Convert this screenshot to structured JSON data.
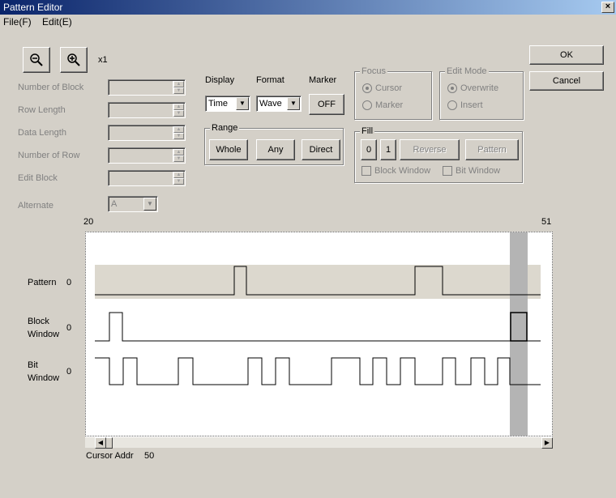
{
  "window": {
    "title": "Pattern Editor",
    "close": "×"
  },
  "menu": {
    "file": "File(F)",
    "edit": "Edit(E)"
  },
  "toolbar": {
    "zoom_level": "x1"
  },
  "buttons": {
    "ok": "OK",
    "cancel": "Cancel"
  },
  "params": {
    "number_of_block": "Number of Block",
    "row_length": "Row Length",
    "data_length": "Data Length",
    "number_of_row": "Number of Row",
    "edit_block": "Edit Block",
    "alternate": "Alternate",
    "alternate_value": "A"
  },
  "display": {
    "display_label": "Display",
    "format_label": "Format",
    "marker_label": "Marker",
    "display_value": "Time",
    "format_value": "Wave",
    "marker_button": "OFF"
  },
  "range": {
    "label": "Range",
    "whole": "Whole",
    "any": "Any",
    "direct": "Direct"
  },
  "focus": {
    "label": "Focus",
    "cursor": "Cursor",
    "marker": "Marker"
  },
  "edit_mode": {
    "label": "Edit Mode",
    "overwrite": "Overwrite",
    "insert": "Insert"
  },
  "fill": {
    "label": "Fill",
    "zero": "0",
    "one": "1",
    "reverse": "Reverse",
    "pattern": "Pattern",
    "block_window": "Block Window",
    "bit_window": "Bit Window"
  },
  "axis": {
    "start": "20",
    "end": "51"
  },
  "signals": {
    "pattern_label": "Pattern",
    "pattern_value": "0",
    "block_label": "Block\nWindow",
    "block_value": "0",
    "bit_label": "Bit\nWindow",
    "bit_value": "0"
  },
  "status": {
    "cursor_addr_label": "Cursor Addr",
    "cursor_addr_value": "50"
  },
  "colors": {
    "pattern_band": "#dcd8ce",
    "cursor_band": "#b4b4b4",
    "titlebar": "#0a246a"
  }
}
